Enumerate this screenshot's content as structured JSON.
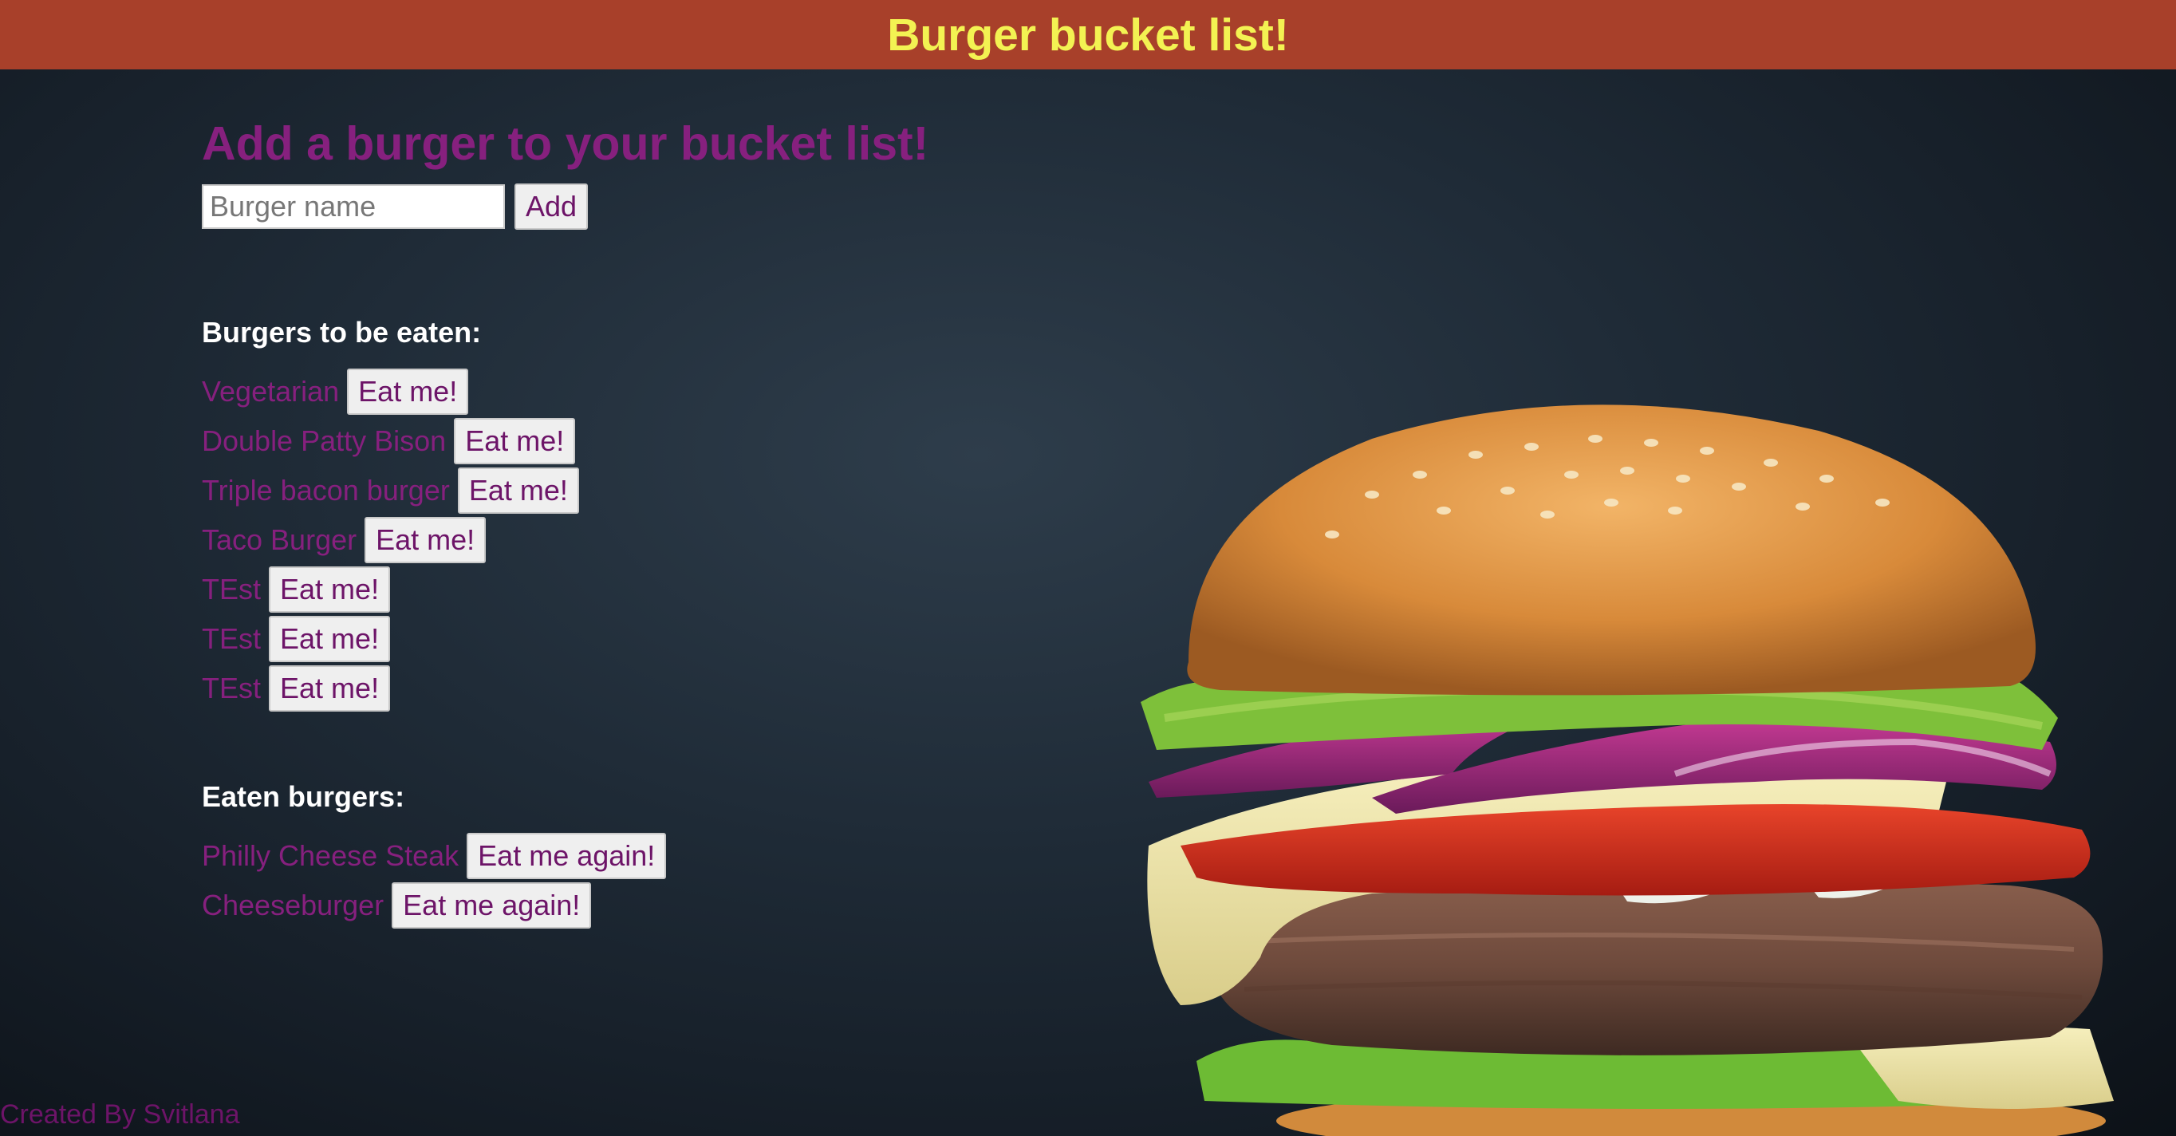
{
  "header": {
    "title": "Burger bucket list!"
  },
  "add_form": {
    "title": "Add a burger to your bucket list!",
    "input_placeholder": "Burger name",
    "add_label": "Add"
  },
  "to_eat": {
    "heading": "Burgers to be eaten:",
    "button_label": "Eat me!",
    "items": [
      "Vegetarian",
      "Double Patty Bison",
      "Triple bacon burger",
      "Taco Burger",
      "TEst",
      "TEst",
      "TEst"
    ]
  },
  "eaten": {
    "heading": "Eaten burgers:",
    "button_label": "Eat me again!",
    "items": [
      "Philly Cheese Steak",
      "Cheeseburger"
    ]
  },
  "footer": {
    "text": "Created By Svitlana"
  },
  "colors": {
    "header_bg": "#a8402a",
    "header_text": "#f3f252",
    "accent_purple": "#86207e",
    "section_heading": "#ffffff"
  },
  "background_image": "burger-photo"
}
